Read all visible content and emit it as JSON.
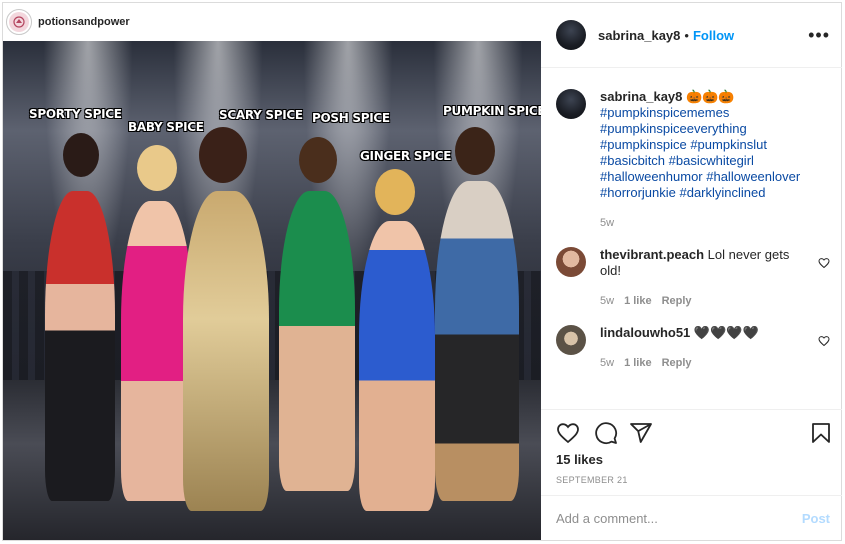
{
  "source": {
    "account_name": "potionsandpower"
  },
  "photo": {
    "labels": {
      "sporty": "SPORTY SPICE",
      "baby": "BABY SPICE",
      "scary": "SCARY SPICE",
      "posh": "POSH SPICE",
      "ginger": "GINGER SPICE",
      "pumpkin": "PUMPKIN SPICE"
    }
  },
  "header": {
    "username": "sabrina_kay8",
    "separator": "•",
    "follow_label": "Follow",
    "more_label": "•••"
  },
  "caption": {
    "username": "sabrina_kay8",
    "emoji": "🎃🎃🎃",
    "hashtags": [
      "#pumpkinspicememes",
      "#pumpkinspiceeverything",
      "#pumpkinspice #pumpkinslut",
      "#basicbitch #basicwhitegirl",
      "#halloweenhumor #halloweenlover",
      "#horrorjunkie #darklyinclined"
    ],
    "age": "5w"
  },
  "comments": [
    {
      "username": "thevibrant.peach",
      "text": "Lol never gets old!",
      "age": "5w",
      "likes": "1 like",
      "reply": "Reply"
    },
    {
      "username": "lindalouwho51",
      "text": "🖤🖤🖤🖤",
      "age": "5w",
      "likes": "1 like",
      "reply": "Reply"
    }
  ],
  "actions": {
    "likes_text": "15 likes",
    "date_text": "SEPTEMBER 21"
  },
  "add_comment": {
    "placeholder": "Add a comment...",
    "post_label": "Post"
  },
  "colors": {
    "accent_link": "#0095f6",
    "hashtag": "#0a4aa3",
    "muted": "#8e8e8e",
    "post_disabled": "#b3dbff"
  },
  "icons": [
    "heart-icon",
    "comment-icon",
    "share-icon",
    "bookmark-icon",
    "more-options-icon",
    "small-heart-icon"
  ]
}
